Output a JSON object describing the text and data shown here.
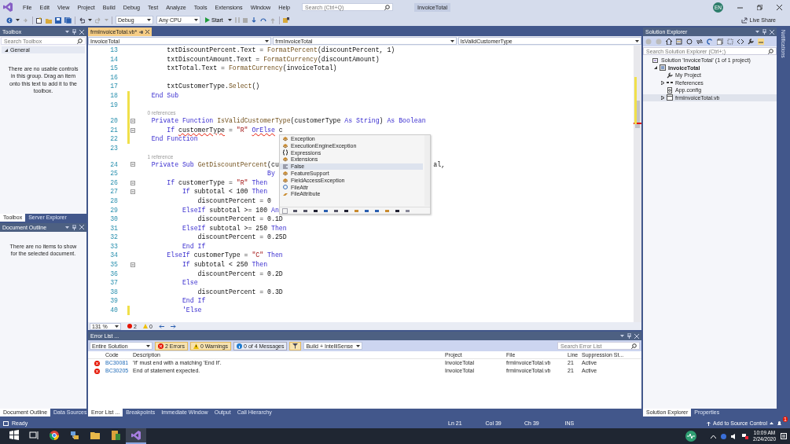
{
  "title_bar": {
    "menus": [
      "File",
      "Edit",
      "View",
      "Project",
      "Build",
      "Debug",
      "Test",
      "Analyze",
      "Tools",
      "Extensions",
      "Window",
      "Help"
    ],
    "search": {
      "placeholder": "Search (Ctrl+Q)"
    },
    "title": "InvoiceTotal",
    "avatar": "EN"
  },
  "toolbar": {
    "configuration": "Debug",
    "platform": "Any CPU",
    "start": "Start",
    "live_share": "Live Share"
  },
  "toolbox": {
    "title": "Toolbox",
    "search": {
      "placeholder": "Search Toolbox"
    },
    "group": {
      "label": "General",
      "expanded": true
    },
    "message": "There are no usable controls in this group. Drag an item onto this text to add it to the toolbox.",
    "tabs": [
      {
        "label": "Toolbox",
        "selected": true
      },
      {
        "label": "Server Explorer",
        "selected": false
      }
    ]
  },
  "document_outline": {
    "title": "Document Outline",
    "message": "There are no items to show for the selected document.",
    "tabs": [
      {
        "label": "Document Outline",
        "selected": true
      },
      {
        "label": "Data Sources",
        "selected": false
      }
    ]
  },
  "editor": {
    "tabs": [
      {
        "label": "frmInvoiceTotal.vb*",
        "selected": true
      }
    ],
    "nav": [
      "InvoiceTotal",
      "frmInvoiceTotal",
      "IsValidCustomerType"
    ],
    "lines": [
      {
        "kind": "code",
        "number": "13",
        "changed": false,
        "foldable": false,
        "tokens": [
          {
            "kind": "plain",
            "text": "        txtDiscountPercent.Text = "
          },
          {
            "kind": "method",
            "text": "FormatPercent"
          },
          {
            "kind": "plain",
            "text": "(discountPercent, 1)"
          }
        ]
      },
      {
        "kind": "code",
        "number": "14",
        "changed": false,
        "foldable": false,
        "tokens": [
          {
            "kind": "plain",
            "text": "        txtDiscountAmount.Text = "
          },
          {
            "kind": "method",
            "text": "FormatCurrency"
          },
          {
            "kind": "plain",
            "text": "(discountAmount)"
          }
        ]
      },
      {
        "kind": "code",
        "number": "15",
        "changed": false,
        "foldable": false,
        "tokens": [
          {
            "kind": "plain",
            "text": "        txtTotal.Text = "
          },
          {
            "kind": "method",
            "text": "FormatCurrency"
          },
          {
            "kind": "plain",
            "text": "(invoiceTotal)"
          }
        ]
      },
      {
        "kind": "code",
        "number": "16",
        "changed": false,
        "foldable": false
      },
      {
        "kind": "code",
        "number": "17",
        "changed": false,
        "foldable": false,
        "tokens": [
          {
            "kind": "plain",
            "text": "        txtCustomerType."
          },
          {
            "kind": "method",
            "text": "Select"
          },
          {
            "kind": "plain",
            "text": "()"
          }
        ]
      },
      {
        "kind": "code",
        "number": "18",
        "changed": true,
        "foldable": false,
        "tokens": [
          {
            "kind": "keyword",
            "text": "    End Sub"
          }
        ]
      },
      {
        "kind": "code",
        "number": "19",
        "changed": true,
        "foldable": false
      },
      {
        "kind": "lens",
        "changed": true,
        "text": "0 references"
      },
      {
        "kind": "code",
        "number": "20",
        "changed": true,
        "foldable": true,
        "tokens": [
          {
            "kind": "keyword",
            "text": "    Private Function "
          },
          {
            "kind": "method",
            "text": "IsValidCustomerType"
          },
          {
            "kind": "plain",
            "text": "(customerType "
          },
          {
            "kind": "keyword",
            "text": "As String"
          },
          {
            "kind": "plain",
            "text": ") "
          },
          {
            "kind": "keyword",
            "text": "As Boolean"
          }
        ]
      },
      {
        "kind": "code",
        "number": "21",
        "changed": true,
        "foldable": true,
        "tokens": [
          {
            "kind": "keyword",
            "text": "        If "
          },
          {
            "kind": "error",
            "text": "customerType"
          },
          {
            "kind": "plain",
            "text": " = "
          },
          {
            "kind": "string",
            "text": "\"R\" "
          },
          {
            "kind": "error-keyword",
            "text": "OrElse"
          },
          {
            "kind": "plain",
            "text": " c"
          }
        ],
        "completion": {
          "items": [
            {
              "label": "Exception",
              "kind": "class",
              "selected": false
            },
            {
              "label": "ExecutionEngineException",
              "kind": "class",
              "selected": false
            },
            {
              "label": "Expressions",
              "kind": "namespace",
              "selected": false
            },
            {
              "label": "Extensions",
              "kind": "class",
              "selected": false
            },
            {
              "label": "False",
              "kind": "keyword",
              "selected": true
            },
            {
              "label": "FeatureSupport",
              "kind": "class",
              "selected": false
            },
            {
              "label": "FieldAccessException",
              "kind": "class",
              "selected": false
            },
            {
              "label": "FileAttr",
              "kind": "structure",
              "selected": false
            },
            {
              "label": "FileAttribute",
              "kind": "enum",
              "selected": false
            }
          ]
        }
      },
      {
        "kind": "code",
        "number": "22",
        "changed": true,
        "foldable": false,
        "tokens": [
          {
            "kind": "keyword",
            "text": "    End Function"
          }
        ]
      },
      {
        "kind": "code",
        "number": "23",
        "changed": false,
        "foldable": false
      },
      {
        "kind": "lens",
        "changed": false,
        "text": "1 reference"
      },
      {
        "kind": "code",
        "number": "24",
        "changed": false,
        "foldable": true,
        "tokens": [
          {
            "kind": "keyword",
            "text": "    Private Sub "
          },
          {
            "kind": "method",
            "text": "GetDiscountPercent"
          },
          {
            "kind": "plain",
            "text": "(cu"
          }
        ],
        "tail": "al,"
      },
      {
        "kind": "code",
        "number": "25",
        "changed": false,
        "foldable": false,
        "tokens": [
          {
            "kind": "keyword",
            "text": "                                  By"
          }
        ]
      },
      {
        "kind": "code",
        "number": "26",
        "changed": false,
        "foldable": true,
        "tokens": [
          {
            "kind": "keyword",
            "text": "        If "
          },
          {
            "kind": "plain",
            "text": "customerType = "
          },
          {
            "kind": "string",
            "text": "\"R\""
          },
          {
            "kind": "keyword",
            "text": " Then"
          }
        ]
      },
      {
        "kind": "code",
        "number": "27",
        "changed": false,
        "foldable": true,
        "tokens": [
          {
            "kind": "keyword",
            "text": "            If "
          },
          {
            "kind": "plain",
            "text": "subtotal < 100 "
          },
          {
            "kind": "keyword",
            "text": "Then"
          }
        ]
      },
      {
        "kind": "code",
        "number": "28",
        "changed": false,
        "foldable": false,
        "tokens": [
          {
            "kind": "plain",
            "text": "                discountPercent = 0"
          }
        ]
      },
      {
        "kind": "code",
        "number": "29",
        "changed": false,
        "foldable": false,
        "tokens": [
          {
            "kind": "keyword",
            "text": "            ElseIf "
          },
          {
            "kind": "plain",
            "text": "subtotal >= 100 "
          },
          {
            "kind": "keyword",
            "text": "An"
          }
        ]
      },
      {
        "kind": "code",
        "number": "30",
        "changed": false,
        "foldable": false,
        "tokens": [
          {
            "kind": "plain",
            "text": "                discountPercent = 0.1D"
          }
        ]
      },
      {
        "kind": "code",
        "number": "31",
        "changed": false,
        "foldable": false,
        "tokens": [
          {
            "kind": "keyword",
            "text": "            ElseIf "
          },
          {
            "kind": "plain",
            "text": "subtotal >= 250 "
          },
          {
            "kind": "keyword",
            "text": "Then"
          }
        ]
      },
      {
        "kind": "code",
        "number": "32",
        "changed": false,
        "foldable": false,
        "tokens": [
          {
            "kind": "plain",
            "text": "                discountPercent = 0.25D"
          }
        ]
      },
      {
        "kind": "code",
        "number": "33",
        "changed": false,
        "foldable": false,
        "tokens": [
          {
            "kind": "keyword",
            "text": "            End If"
          }
        ]
      },
      {
        "kind": "code",
        "number": "34",
        "changed": false,
        "foldable": false,
        "tokens": [
          {
            "kind": "keyword",
            "text": "        ElseIf "
          },
          {
            "kind": "plain",
            "text": "customerType = "
          },
          {
            "kind": "string",
            "text": "\"C\""
          },
          {
            "kind": "keyword",
            "text": " Then"
          }
        ]
      },
      {
        "kind": "code",
        "number": "35",
        "changed": false,
        "foldable": true,
        "tokens": [
          {
            "kind": "keyword",
            "text": "            If "
          },
          {
            "kind": "plain",
            "text": "subtotal < 250 "
          },
          {
            "kind": "keyword",
            "text": "Then"
          }
        ]
      },
      {
        "kind": "code",
        "number": "36",
        "changed": false,
        "foldable": false,
        "tokens": [
          {
            "kind": "plain",
            "text": "                discountPercent = 0.2D"
          }
        ]
      },
      {
        "kind": "code",
        "number": "37",
        "changed": false,
        "foldable": false,
        "tokens": [
          {
            "kind": "keyword",
            "text": "            Else"
          }
        ]
      },
      {
        "kind": "code",
        "number": "38",
        "changed": false,
        "foldable": false,
        "tokens": [
          {
            "kind": "plain",
            "text": "                discountPercent = 0.3D"
          }
        ]
      },
      {
        "kind": "code",
        "number": "39",
        "changed": false,
        "foldable": false,
        "tokens": [
          {
            "kind": "keyword",
            "text": "            End If"
          }
        ]
      },
      {
        "kind": "code",
        "number": "40",
        "changed": true,
        "foldable": false,
        "tokens": [
          {
            "kind": "comment",
            "text": "            'Else"
          }
        ]
      }
    ],
    "zoom": "131 %",
    "errors": "2",
    "warnings": "0"
  },
  "error_list": {
    "title": "Error List ...",
    "scope": "Entire Solution",
    "filters": [
      {
        "kind": "error",
        "label": "2 Errors",
        "selected": true
      },
      {
        "kind": "warning",
        "label": "0 Warnings",
        "selected": true
      },
      {
        "kind": "info",
        "label": "0 of 4 Messages",
        "selected": false
      }
    ],
    "source": "Build + IntelliSense",
    "search": {
      "placeholder": "Search Error List"
    },
    "columns": [
      "Code",
      "Description",
      "Project",
      "File",
      "Line",
      "Suppression St..."
    ],
    "rows": [
      {
        "code": "BC30081",
        "description": "'If' must end with a matching 'End If'.",
        "project": "InvoiceTotal",
        "file": "frmInvoiceTotal.vb",
        "line": "21",
        "suppression": "Active"
      },
      {
        "code": "BC30205",
        "description": "End of statement expected.",
        "project": "InvoiceTotal",
        "file": "frmInvoiceTotal.vb",
        "line": "21",
        "suppression": "Active"
      }
    ],
    "tabs": [
      {
        "label": "Error List ...",
        "selected": true
      },
      {
        "label": "Breakpoints",
        "selected": false
      },
      {
        "label": "Immediate Window",
        "selected": false
      },
      {
        "label": "Output",
        "selected": false
      },
      {
        "label": "Call Hierarchy",
        "selected": false
      }
    ]
  },
  "solution_explorer": {
    "title": "Solution Explorer",
    "search": {
      "placeholder": "Search Solution Explorer (Ctrl+;)"
    },
    "tree": [
      {
        "label": "Solution 'InvoiceTotal' (1 of 1 project)",
        "kind": "solution",
        "selected": false,
        "children": [
          {
            "label": "InvoiceTotal",
            "kind": "project",
            "expanded": true,
            "selected": false,
            "children": [
              {
                "label": "My Project",
                "kind": "wrench",
                "selected": false
              },
              {
                "label": "References",
                "kind": "references",
                "expanded": false,
                "selected": false
              },
              {
                "label": "App.config",
                "kind": "config",
                "selected": false
              },
              {
                "label": "frmInvoiceTotal.vb",
                "kind": "form",
                "expanded": false,
                "selected": true
              }
            ]
          }
        ]
      }
    ],
    "tabs": [
      {
        "label": "Solution Explorer",
        "selected": true
      },
      {
        "label": "Properties",
        "selected": false
      }
    ]
  },
  "notifications": "Notifications",
  "status_bar": {
    "state": "Ready",
    "line": "Ln 21",
    "column": "Col 39",
    "char": "Ch 39",
    "mode": "INS",
    "source_control": "Add to Source Control",
    "badge": "1"
  },
  "taskbar": {
    "apps": [
      {
        "kind": "start",
        "active": false
      },
      {
        "kind": "task-view",
        "active": false
      },
      {
        "kind": "browser",
        "active": false
      },
      {
        "kind": "network",
        "active": false
      },
      {
        "kind": "folder",
        "active": false
      },
      {
        "kind": "database",
        "active": false
      },
      {
        "kind": "visual-studio",
        "active": true
      }
    ],
    "time": "10:09 AM",
    "date": "2/24/2020"
  }
}
